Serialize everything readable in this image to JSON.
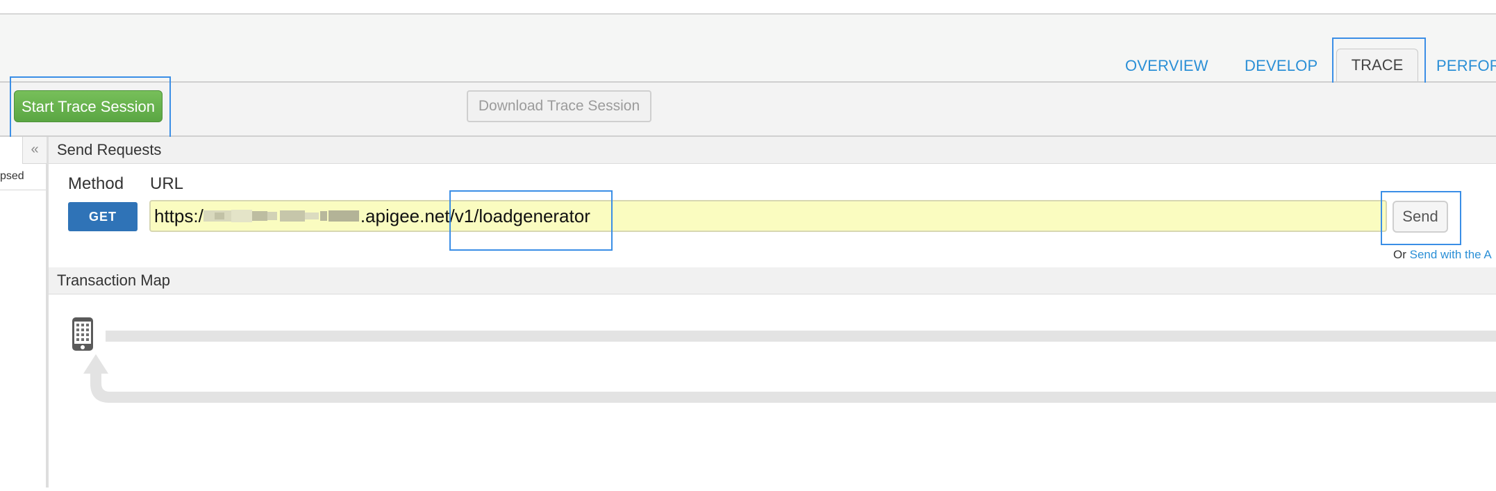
{
  "tabs": {
    "overview": "OVERVIEW",
    "develop": "DEVELOP",
    "trace": "TRACE",
    "performance": "PERFOR"
  },
  "toolbar": {
    "start_label": "Start Trace Session",
    "download_label": "Download Trace Session"
  },
  "left_panel": {
    "collapsed_label": "psed",
    "collapse_icon": "«"
  },
  "send_requests": {
    "title": "Send Requests",
    "method_label": "Method",
    "url_label": "URL",
    "method_value": "GET",
    "url_prefix": "https:/",
    "url_suffix": ".apigee.net/v1/loadgenerator",
    "send_label": "Send",
    "or_text": "Or",
    "send_with_link": "Send with the A"
  },
  "transaction_map": {
    "title": "Transaction Map"
  },
  "colors": {
    "accent": "#2a8fd6",
    "start_button": "#5aa643",
    "get_button": "#2f73b7",
    "url_field": "#fafcc0",
    "highlight": "#3a8ee6"
  }
}
